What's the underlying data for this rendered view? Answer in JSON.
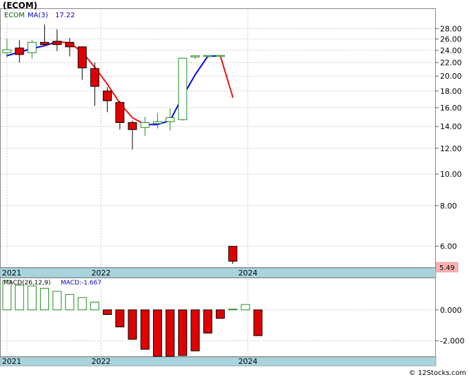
{
  "header": {
    "symbol": "(ECOM)",
    "legend_symbol": "ECOM",
    "ma_label": "MA(3)",
    "ma_value": "17.22",
    "macd_label": "MACD(26,12,9)",
    "macd_value_label": "MACD:-1.667",
    "last_price": "5.49",
    "watermark": "© 12Stocks.com"
  },
  "colors": {
    "up": "#228b22",
    "down": "#e00000",
    "ma_up": "#0000ee",
    "ma_down": "#ee1111",
    "axis_band": "#a9d4de",
    "last_price_bg": "#ffb3b3"
  },
  "chart_data": [
    {
      "type": "candlestick",
      "title": "(ECOM)",
      "scale": "log",
      "ylim": [
        5.2,
        32
      ],
      "yticks": [
        "28.00",
        "26.00",
        "24.00",
        "22.00",
        "20.00",
        "18.00",
        "16.00",
        "14.00",
        "12.00",
        "10.00",
        "8.00",
        "6.00"
      ],
      "x_labels": [
        {
          "label": "2021",
          "index": 0
        },
        {
          "label": "2022",
          "index": 7.5
        },
        {
          "label": "2024",
          "index": 19.2
        }
      ],
      "candles": [
        {
          "o": 23.6,
          "h": 26.0,
          "l": 22.8,
          "c": 24.1
        },
        {
          "o": 24.4,
          "h": 25.8,
          "l": 22.0,
          "c": 23.3
        },
        {
          "o": 23.6,
          "h": 25.8,
          "l": 22.6,
          "c": 25.4
        },
        {
          "o": 25.4,
          "h": 28.8,
          "l": 24.8,
          "c": 25.0
        },
        {
          "o": 25.6,
          "h": 27.8,
          "l": 23.9,
          "c": 25.0
        },
        {
          "o": 25.4,
          "h": 26.2,
          "l": 23.0,
          "c": 24.6
        },
        {
          "o": 24.6,
          "h": 24.7,
          "l": 19.5,
          "c": 21.2
        },
        {
          "o": 21.1,
          "h": 22.0,
          "l": 16.2,
          "c": 18.6
        },
        {
          "o": 18.0,
          "h": 18.5,
          "l": 15.5,
          "c": 16.8
        },
        {
          "o": 16.6,
          "h": 16.8,
          "l": 13.7,
          "c": 14.4
        },
        {
          "o": 14.4,
          "h": 14.6,
          "l": 11.9,
          "c": 13.7
        },
        {
          "o": 13.9,
          "h": 15.0,
          "l": 13.1,
          "c": 14.4
        },
        {
          "o": 14.3,
          "h": 15.4,
          "l": 13.8,
          "c": 14.5
        },
        {
          "o": 14.5,
          "h": 15.9,
          "l": 13.6,
          "c": 14.9
        },
        {
          "o": 14.7,
          "h": 22.7,
          "l": 14.6,
          "c": 22.7
        },
        {
          "o": 22.9,
          "h": 23.1,
          "l": 22.6,
          "c": 23.1
        },
        {
          "o": 23.1,
          "h": 23.2,
          "l": 23.0,
          "c": 23.15
        },
        {
          "o": 23.15,
          "h": 23.2,
          "l": 23.1,
          "c": 23.15
        },
        {
          "o": 6.0,
          "h": 6.0,
          "l": 5.3,
          "c": 5.4
        }
      ],
      "ma": [
        {
          "i": 0,
          "v": 23.1
        },
        {
          "i": 1,
          "v": 23.7
        },
        {
          "i": 2,
          "v": 24.3
        },
        {
          "i": 3,
          "v": 24.8
        },
        {
          "i": 4,
          "v": 25.5
        },
        {
          "i": 5,
          "v": 25.3
        },
        {
          "i": 6,
          "v": 23.7
        },
        {
          "i": 7,
          "v": 21.3
        },
        {
          "i": 8,
          "v": 18.9
        },
        {
          "i": 9,
          "v": 16.5
        },
        {
          "i": 10,
          "v": 14.9
        },
        {
          "i": 11,
          "v": 14.2
        },
        {
          "i": 12,
          "v": 14.2
        },
        {
          "i": 13,
          "v": 14.6
        },
        {
          "i": 14,
          "v": 17.3
        },
        {
          "i": 15,
          "v": 20.2
        },
        {
          "i": 16,
          "v": 23.0
        },
        {
          "i": 17,
          "v": 23.1
        },
        {
          "i": 18,
          "v": 17.22
        }
      ]
    },
    {
      "type": "bar",
      "title": "MACD(26,12,9)",
      "ylim": [
        -3.0,
        2.0
      ],
      "yticks": [
        "0.000",
        "-2.000"
      ],
      "ytick_values": [
        0,
        -2
      ],
      "x_labels": [
        {
          "label": "2021",
          "index": 0
        },
        {
          "label": "2022",
          "index": 7.5
        },
        {
          "label": "2024",
          "index": 19.2
        }
      ],
      "values": [
        1.9,
        1.6,
        1.55,
        1.4,
        1.2,
        1.0,
        0.8,
        0.5,
        -0.3,
        -1.1,
        -1.9,
        -2.55,
        -3.0,
        -3.0,
        -2.95,
        -2.65,
        -1.5,
        -0.55,
        0.05,
        0.35,
        -1.667
      ]
    }
  ]
}
